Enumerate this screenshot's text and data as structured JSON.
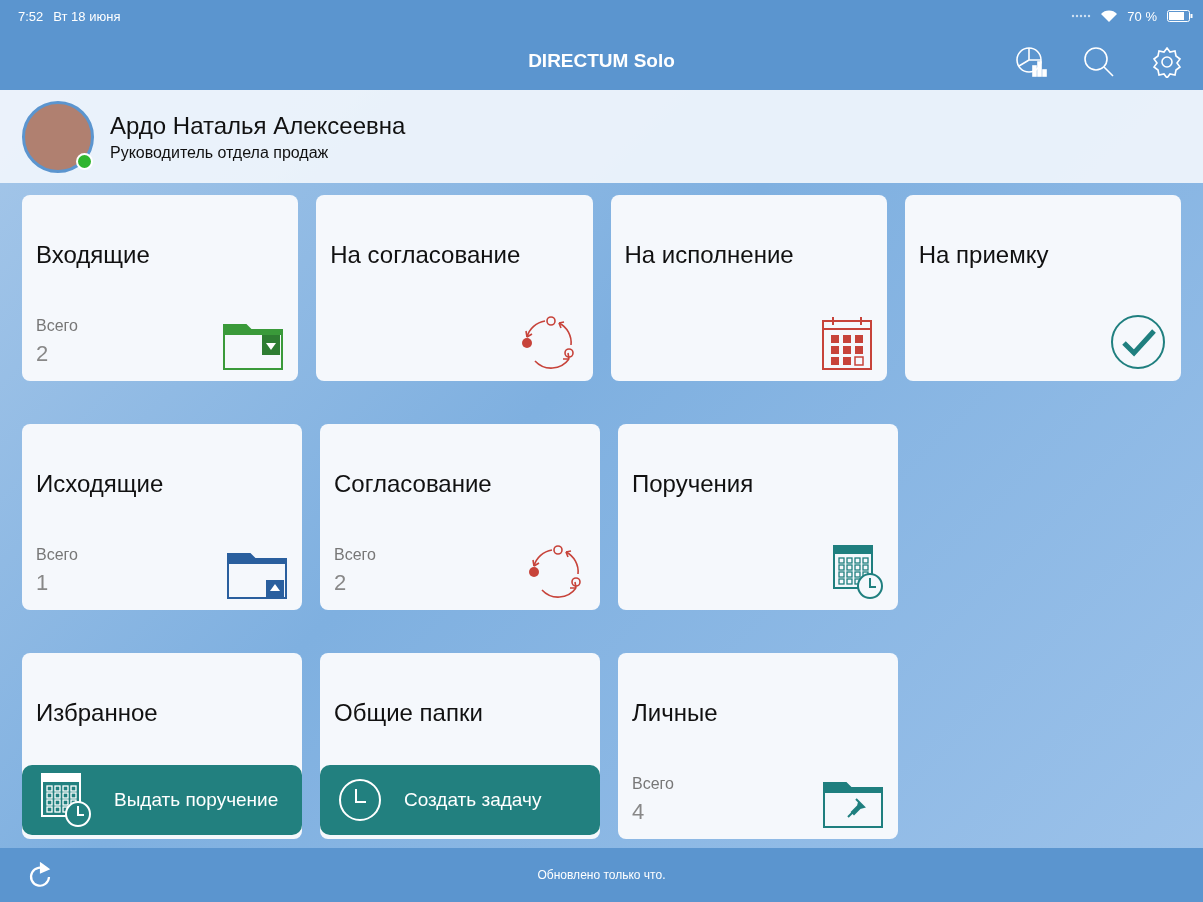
{
  "status_bar": {
    "time": "7:52",
    "date": "Вт 18 июня",
    "battery": "70 %"
  },
  "header": {
    "title": "DIRECTUM Solo"
  },
  "profile": {
    "name": "Ардо Наталья Алексеевна",
    "position": "Руководитель отдела продаж",
    "online": true
  },
  "tile_rows": [
    [
      {
        "title": "Входящие",
        "count_label": "Всего",
        "count": "2",
        "kind": "incoming"
      },
      {
        "title": "На согласование",
        "kind": "approval"
      },
      {
        "title": "На исполнение",
        "kind": "execution"
      },
      {
        "title": "На приемку",
        "kind": "acceptance"
      }
    ],
    [
      {
        "title": "Исходящие",
        "count_label": "Всего",
        "count": "1",
        "kind": "outgoing"
      },
      {
        "title": "Согласование",
        "count_label": "Всего",
        "count": "2",
        "kind": "approval"
      },
      {
        "title": "Поручения",
        "kind": "assignments"
      }
    ],
    [
      {
        "title": "Избранное",
        "kind": "favorites",
        "action": {
          "label": "Выдать поручение",
          "kind": "assignment"
        }
      },
      {
        "title": "Общие папки",
        "kind": "shared",
        "action": {
          "label": "Создать задачу",
          "kind": "task"
        }
      },
      {
        "title": "Личные",
        "count_label": "Всего",
        "count": "4",
        "kind": "personal"
      }
    ]
  ],
  "footer": {
    "status": "Обновлено только что."
  }
}
